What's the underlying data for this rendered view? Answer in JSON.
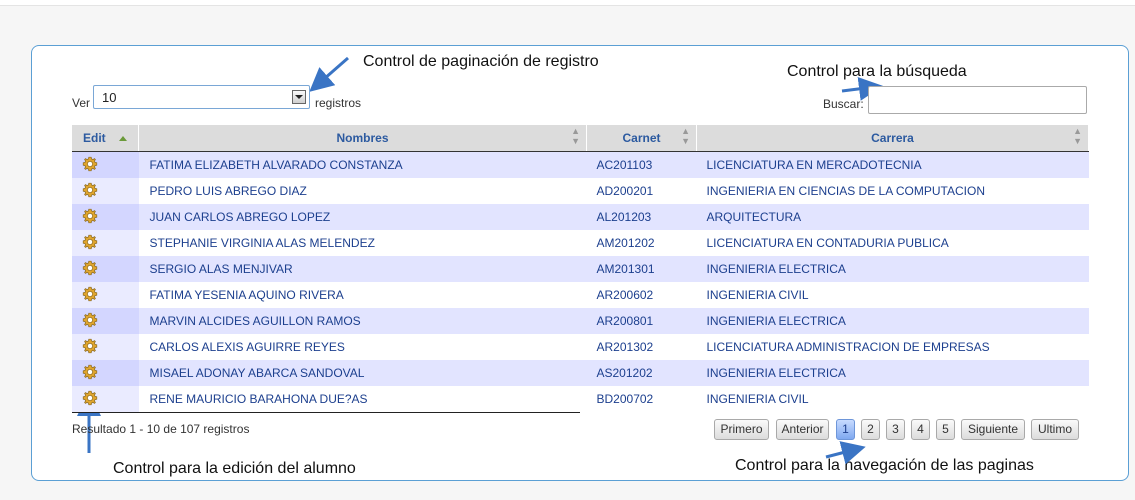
{
  "annotations": {
    "pagination_control": "Control de paginación de registro",
    "search_control": "Control para la búsqueda",
    "edit_control": "Control para la edición del alumno",
    "page_nav_control": "Control para la navegación de las paginas"
  },
  "length": {
    "prefix": "Ver",
    "value": "10",
    "suffix": "registros"
  },
  "search": {
    "label": "Buscar:",
    "value": ""
  },
  "table": {
    "headers": {
      "edit": "Edit",
      "nombres": "Nombres",
      "carnet": "Carnet",
      "carrera": "Carrera"
    },
    "rows": [
      {
        "nombre": "FATIMA ELIZABETH ALVARADO CONSTANZA",
        "carnet": "AC201103",
        "carrera": "LICENCIATURA EN MERCADOTECNIA"
      },
      {
        "nombre": "PEDRO LUIS ABREGO DIAZ",
        "carnet": "AD200201",
        "carrera": "INGENIERIA EN CIENCIAS DE LA COMPUTACION"
      },
      {
        "nombre": "JUAN CARLOS ABREGO LOPEZ",
        "carnet": "AL201203",
        "carrera": "ARQUITECTURA"
      },
      {
        "nombre": "STEPHANIE VIRGINIA ALAS MELENDEZ",
        "carnet": "AM201202",
        "carrera": "LICENCIATURA EN CONTADURIA PUBLICA"
      },
      {
        "nombre": "SERGIO ALAS MENJIVAR",
        "carnet": "AM201301",
        "carrera": "INGENIERIA ELECTRICA"
      },
      {
        "nombre": "FATIMA YESENIA AQUINO RIVERA",
        "carnet": "AR200602",
        "carrera": "INGENIERIA CIVIL"
      },
      {
        "nombre": "MARVIN ALCIDES AGUILLON RAMOS",
        "carnet": "AR200801",
        "carrera": "INGENIERIA ELECTRICA"
      },
      {
        "nombre": "CARLOS ALEXIS AGUIRRE REYES",
        "carnet": "AR201302",
        "carrera": "LICENCIATURA ADMINISTRACION DE EMPRESAS"
      },
      {
        "nombre": "MISAEL ADONAY ABARCA SANDOVAL",
        "carnet": "AS201202",
        "carrera": "INGENIERIA ELECTRICA"
      },
      {
        "nombre": "RENE MAURICIO BARAHONA DUE?AS",
        "carnet": "BD200702",
        "carrera": "INGENIERIA CIVIL"
      }
    ]
  },
  "info": "Resultado 1 - 10 de 107 registros",
  "pagination": {
    "first": "Primero",
    "previous": "Anterior",
    "pages": [
      "1",
      "2",
      "3",
      "4",
      "5"
    ],
    "current": "1",
    "next": "Siguiente",
    "last": "Ultimo"
  },
  "colors": {
    "arrow": "#3a74c4",
    "link": "#1c3f8e",
    "panel_border": "#5b9fd4"
  }
}
